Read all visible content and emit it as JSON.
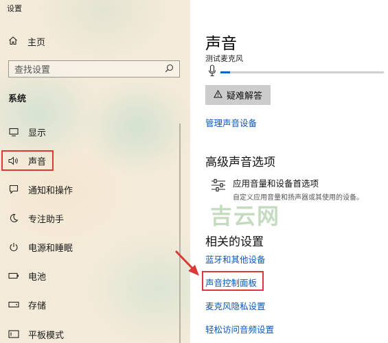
{
  "window": {
    "title": "设置"
  },
  "sidebar": {
    "home_label": "主页",
    "search_placeholder": "查找设置",
    "section_title": "系统",
    "items": [
      {
        "label": "显示",
        "icon": "monitor-icon"
      },
      {
        "label": "声音",
        "icon": "speaker-icon",
        "selected": true
      },
      {
        "label": "通知和操作",
        "icon": "notification-icon"
      },
      {
        "label": "专注助手",
        "icon": "moon-icon"
      },
      {
        "label": "电源和睡眠",
        "icon": "power-icon"
      },
      {
        "label": "电池",
        "icon": "battery-icon"
      },
      {
        "label": "存储",
        "icon": "storage-icon"
      },
      {
        "label": "平板模式",
        "icon": "tablet-icon"
      }
    ]
  },
  "main": {
    "title": "声音",
    "mic_label": "测试麦克风",
    "mic_level_fraction": 0.06,
    "troubleshoot_label": "疑难解答",
    "manage_link": "管理声音设备",
    "advanced": {
      "heading": "高级声音选项",
      "item_title": "应用音量和设备首选项",
      "item_desc": "自定义应用音量和扬声器或其使用的设备。"
    },
    "related": {
      "heading": "相关的设置",
      "links": [
        "蓝牙和其他设备",
        "声音控制面板",
        "麦克风隐私设置",
        "轻松访问音频设置"
      ]
    }
  },
  "watermark": "吉云网",
  "colors": {
    "highlight": "#d93a35",
    "link": "#0b58b8",
    "accent": "#0b64c0"
  }
}
